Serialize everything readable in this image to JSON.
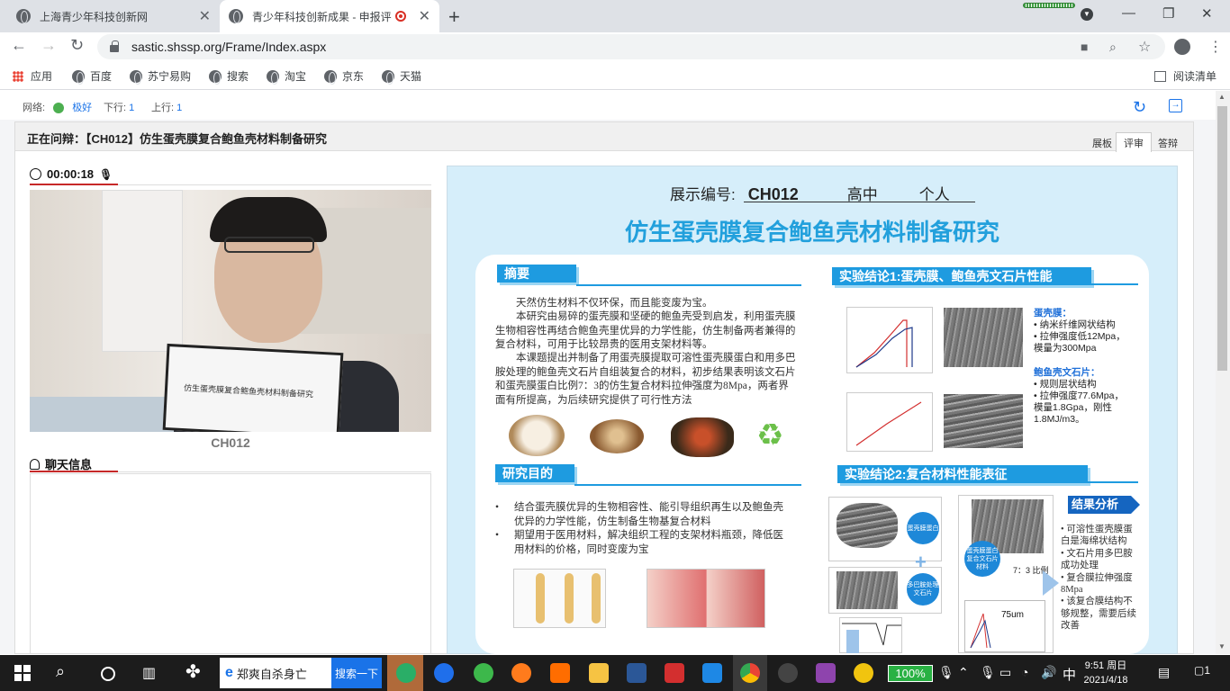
{
  "browser": {
    "tabs": [
      {
        "title": "上海青少年科技创新网",
        "active": false
      },
      {
        "title": "青少年科技创新成果 - 申报评",
        "active": true
      }
    ],
    "url": "sastic.shssp.org/Frame/Index.aspx",
    "bookmarks": [
      "应用",
      "百度",
      "苏宁易购",
      "搜索",
      "淘宝",
      "京东",
      "天猫"
    ],
    "reading_list": "阅读清单"
  },
  "status": {
    "network_label": "网络:",
    "network_value": "极好",
    "down_label": "下行:",
    "down_value": "1",
    "up_label": "上行:",
    "up_value": "1"
  },
  "panel": {
    "title": "正在问辩：【CH012】仿生蛋壳膜复合鲍鱼壳材料制备研究",
    "tabs": [
      "展板",
      "评审",
      "答辩"
    ],
    "active_tab": "评审"
  },
  "video": {
    "timer": "00:00:18",
    "participant": "CH012",
    "laptop_text": "仿生蛋壳膜复合鲍鱼壳材料制备研究"
  },
  "chat": {
    "title": "聊天信息"
  },
  "poster": {
    "meta_label": "展示编号:",
    "code": "CH012",
    "grade": "高中",
    "type": "个人",
    "title": "仿生蛋壳膜复合鲍鱼壳材料制备研究",
    "abstract_head": "摘要",
    "abstract_1": "天然仿生材料不仅环保，而且能变废为宝。",
    "abstract_2": "本研究由易碎的蛋壳膜和坚硬的鲍鱼壳受到启发，利用蛋壳膜生物相容性再结合鲍鱼壳里优异的力学性能，仿生制备两者兼得的复合材料，可用于比较昂贵的医用支架材料等。",
    "abstract_3": "本课题提出并制备了用蛋壳膜提取可溶性蛋壳膜蛋白和用多巴胺处理的鲍鱼壳文石片自组装复合的材料，初步结果表明该文石片和蛋壳膜蛋白比例7：3的仿生复合材料拉伸强度为8Mpa，两者界面有所提高，为后续研究提供了可行性方法",
    "purpose_head": "研究目的",
    "purpose_1": "结合蛋壳膜优异的生物相容性、能引导组织再生以及鲍鱼壳优异的力学性能，仿生制备生物基复合材料",
    "purpose_2": "期望用于医用材料，解决组织工程的支架材料瓶颈，降低医用材料的价格，同时变废为宝",
    "result1_head": "实验结论1:蛋壳膜、鲍鱼壳文石片性能",
    "eggshell_title": "蛋壳膜：",
    "eggshell_items": [
      "纳米纤维网状结构",
      "拉伸强度低12Mpa，模量为300Mpa"
    ],
    "abalone_title": "鲍鱼壳文石片：",
    "abalone_items": [
      "规则层状结构",
      "拉伸强度77.6Mpa，模量1.8Gpa，刚性1.8MJ/m3。"
    ],
    "result2_head": "实验结论2:复合材料性能表征",
    "analysis_head": "结果分析",
    "analysis_items": [
      "可溶性蛋壳膜蛋白是海绵状结构",
      "文石片用多巴胺成功处理",
      "复合膜拉伸强度8Mpa",
      "该复合膜结构不够规整，需要后续改善"
    ],
    "circle_1": "蛋壳膜蛋白",
    "circle_2": "多巴胺处理文石片",
    "circle_3": "蛋壳膜蛋白复合文石片材料",
    "ratio_label": "7：3 比例",
    "scale_label": "75um"
  },
  "taskbar": {
    "search_text": "郑爽自杀身亡",
    "search_button": "搜索一下",
    "battery": "100%",
    "ime": "中",
    "time": "9:51 周日",
    "date": "2021/4/18",
    "notifications": "1"
  }
}
